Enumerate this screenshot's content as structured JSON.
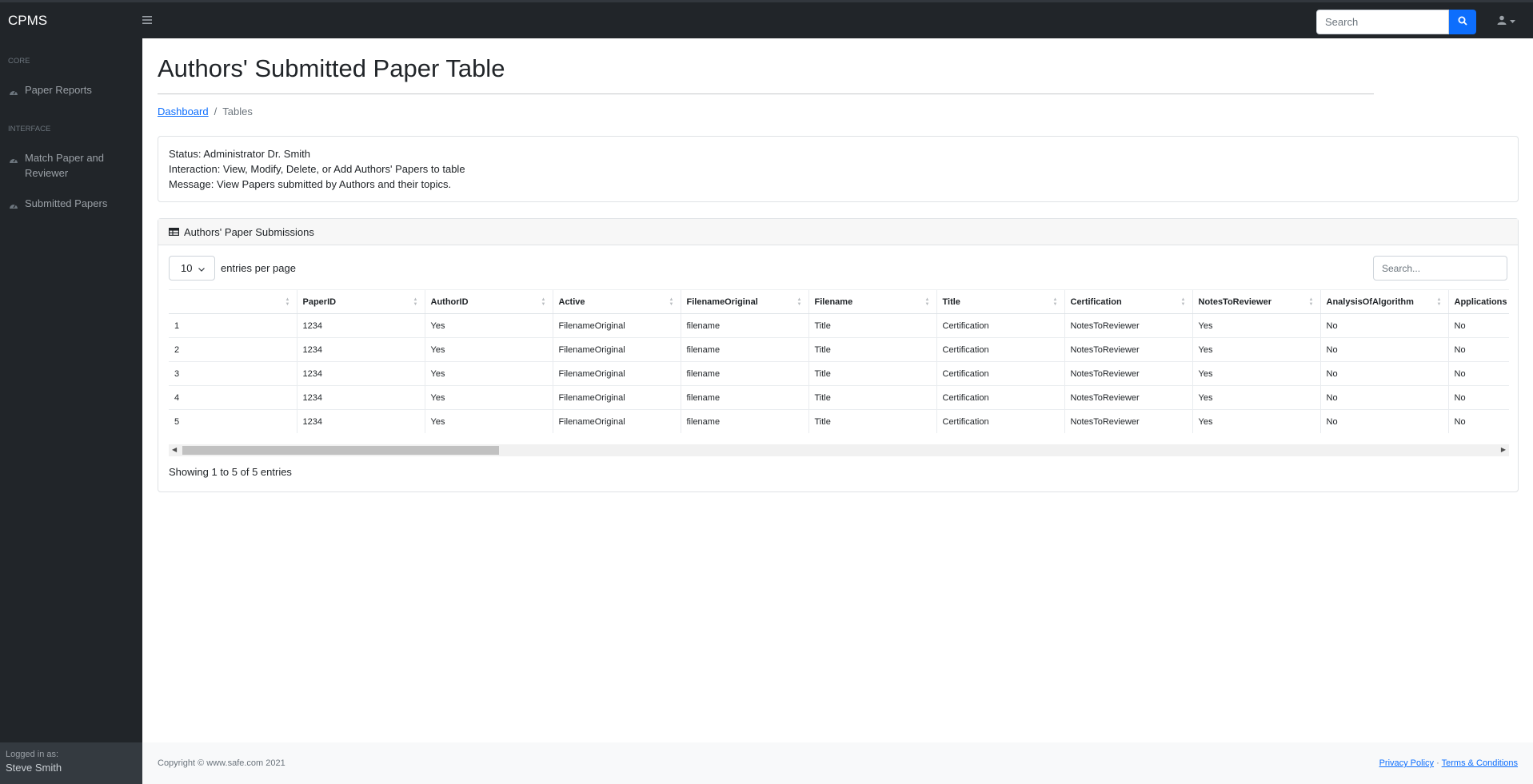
{
  "app": {
    "brand": "CPMS"
  },
  "topnav": {
    "search_placeholder": "Search"
  },
  "sidebar": {
    "core_heading": "Core",
    "interface_heading": "Interface",
    "items": [
      {
        "label": "Paper Reports",
        "icon": "tachometer-icon"
      },
      {
        "label": "Match Paper and Reviewer",
        "icon": "tachometer-icon"
      },
      {
        "label": "Submitted Papers",
        "icon": "tachometer-icon"
      }
    ],
    "footer": {
      "logged_in_label": "Logged in as:",
      "user_name": "Steve Smith"
    }
  },
  "page": {
    "title": "Authors' Submitted Paper Table"
  },
  "breadcrumb": {
    "link": "Dashboard",
    "current": "Tables"
  },
  "status_card": {
    "status": "Status: Administrator Dr. Smith",
    "interaction": "Interaction: View, Modify, Delete, or Add Authors' Papers to table",
    "message": "Message: View Papers submitted by Authors and their topics."
  },
  "table_card": {
    "header": "Authors' Paper Submissions",
    "entries_value": "10",
    "entries_label": "entries per page",
    "search_placeholder": "Search...",
    "columns": [
      "",
      "PaperID",
      "AuthorID",
      "Active",
      "FilenameOriginal",
      "Filename",
      "Title",
      "Certification",
      "NotesToReviewer",
      "AnalysisOfAlgorithm",
      "Applications"
    ],
    "rows": [
      [
        "1",
        "1234",
        "Yes",
        "FilenameOriginal",
        "filename",
        "Title",
        "Certification",
        "NotesToReviewer",
        "Yes",
        "No",
        "No"
      ],
      [
        "2",
        "1234",
        "Yes",
        "FilenameOriginal",
        "filename",
        "Title",
        "Certification",
        "NotesToReviewer",
        "Yes",
        "No",
        "No"
      ],
      [
        "3",
        "1234",
        "Yes",
        "FilenameOriginal",
        "filename",
        "Title",
        "Certification",
        "NotesToReviewer",
        "Yes",
        "No",
        "No"
      ],
      [
        "4",
        "1234",
        "Yes",
        "FilenameOriginal",
        "filename",
        "Title",
        "Certification",
        "NotesToReviewer",
        "Yes",
        "No",
        "No"
      ],
      [
        "5",
        "1234",
        "Yes",
        "FilenameOriginal",
        "filename",
        "Title",
        "Certification",
        "NotesToReviewer",
        "Yes",
        "No",
        "No"
      ]
    ],
    "info": "Showing 1 to 5 of 5 entries"
  },
  "footer": {
    "copyright": "Copyright © www.safe.com 2021",
    "privacy": "Privacy Policy",
    "separator": "·",
    "terms": "Terms & Conditions"
  },
  "colors": {
    "nav_bg": "#212529",
    "accent": "#0d6efd",
    "footer_bg": "#f8f9fa"
  }
}
